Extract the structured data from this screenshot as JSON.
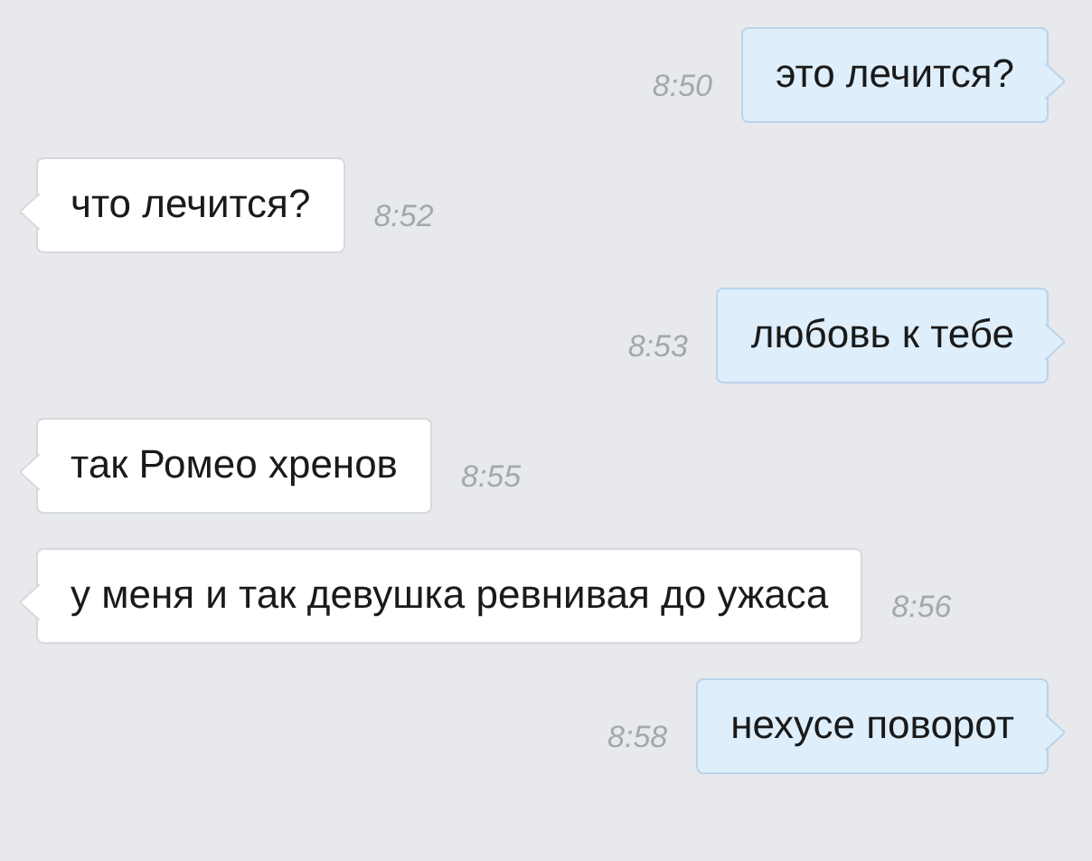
{
  "messages": [
    {
      "kind": "outgoing",
      "text": "это лечится?",
      "time": "8:50"
    },
    {
      "kind": "incoming",
      "text": "что лечится?",
      "time": "8:52"
    },
    {
      "kind": "outgoing",
      "text": "любовь к тебе",
      "time": "8:53"
    },
    {
      "kind": "incoming",
      "text": "так Ромео хренов",
      "time": "8:55"
    },
    {
      "kind": "incoming",
      "text": "у меня и так девушка ревнивая до ужаса",
      "time": "8:56"
    },
    {
      "kind": "outgoing",
      "text": "нехусе поворот",
      "time": "8:58"
    }
  ]
}
